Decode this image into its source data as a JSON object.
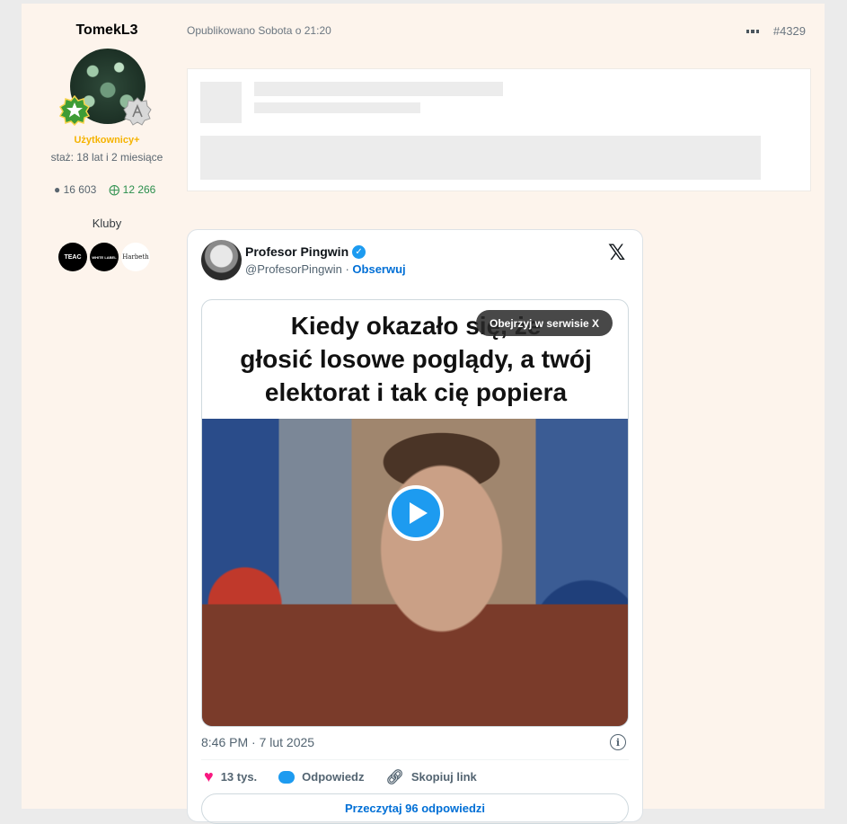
{
  "author": {
    "name": "TomekL3",
    "group": "Użytkownicy+",
    "tenure": "staż: 18 lat i 2 miesiące",
    "posts": "16 603",
    "reputation": "12 266",
    "clubs_label": "Kluby",
    "clubs": [
      "TEAC",
      "WHITE LABEL",
      "Harbeth"
    ]
  },
  "post": {
    "meta": "Opublikowano Sobota o 21:20",
    "number": "#4329"
  },
  "tweet": {
    "name": "Profesor Pingwin",
    "handle": "@ProfesorPingwin · ",
    "follow": "Obserwuj",
    "x_logo": "𝕏",
    "caption_lines": [
      "Kiedy okazało się, że",
      "głosić losowe poglądy, a twój",
      "elektorat i tak cię popiera"
    ],
    "watch_on_x": "Obejrzyj w serwisie X",
    "time": "8:46 PM · 7 lut 2025",
    "likes": "13 tys.",
    "reply": "Odpowiedz",
    "copy_link": "Skopiuj link",
    "read_replies": "Przeczytaj 96 odpowiedzi"
  },
  "colors": {
    "post_bg": "#fdf4ec",
    "group": "#f5b300",
    "reputation": "#2c8f4d",
    "x_blue": "#1d9bf0",
    "like_pink": "#f91880"
  },
  "icons": [
    "comment-icon",
    "plus-circle-icon",
    "verified-icon",
    "x-logo-icon",
    "play-icon",
    "info-icon",
    "heart-icon",
    "reply-bubble-icon",
    "link-icon",
    "more-dots-icon"
  ]
}
